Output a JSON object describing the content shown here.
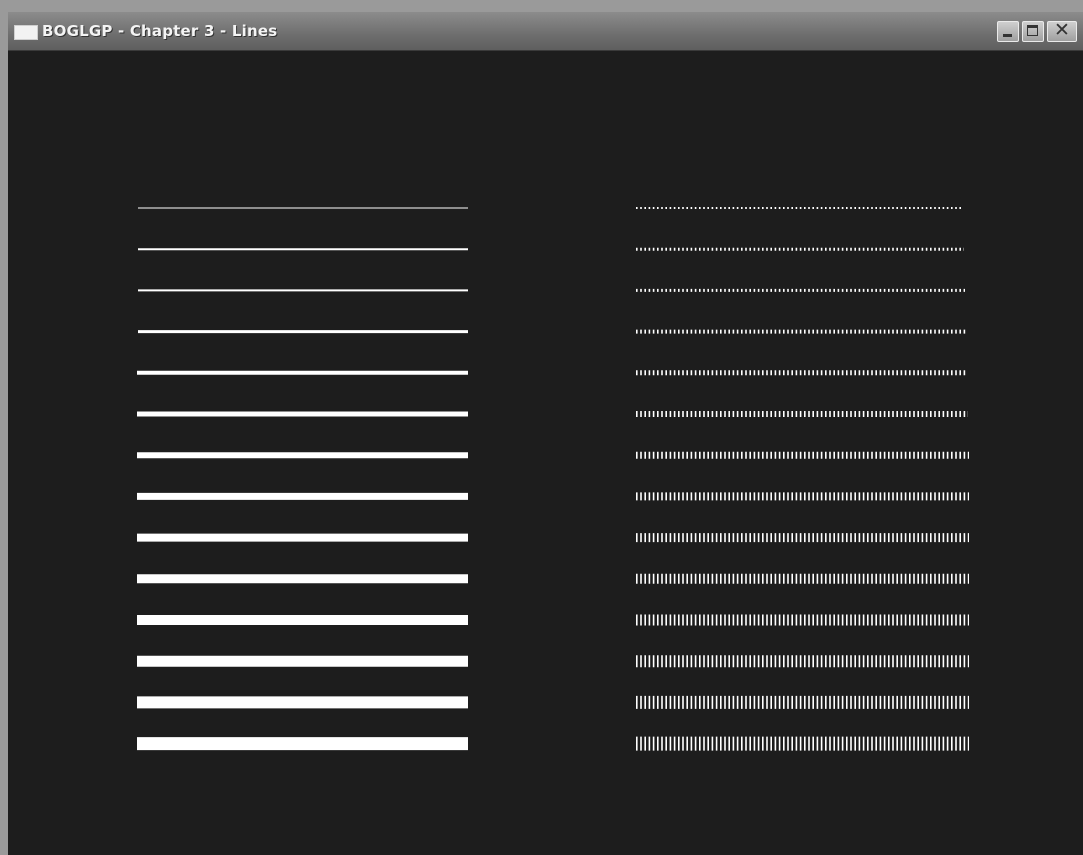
{
  "window": {
    "title": "BOGLGP - Chapter 3 - Lines",
    "controls": {
      "minimize": "minimize",
      "maximize": "maximize",
      "close": "close"
    }
  },
  "scene": {
    "background_color": "#1d1d1d",
    "line_color": "#ffffff",
    "line_count": 14,
    "line_widths": [
      1,
      2,
      2,
      3,
      4,
      5,
      6,
      7,
      8,
      9,
      10,
      11,
      12,
      13
    ],
    "dashed_lines_note": "right column: stippled (dotted) lines of increasing width"
  }
}
